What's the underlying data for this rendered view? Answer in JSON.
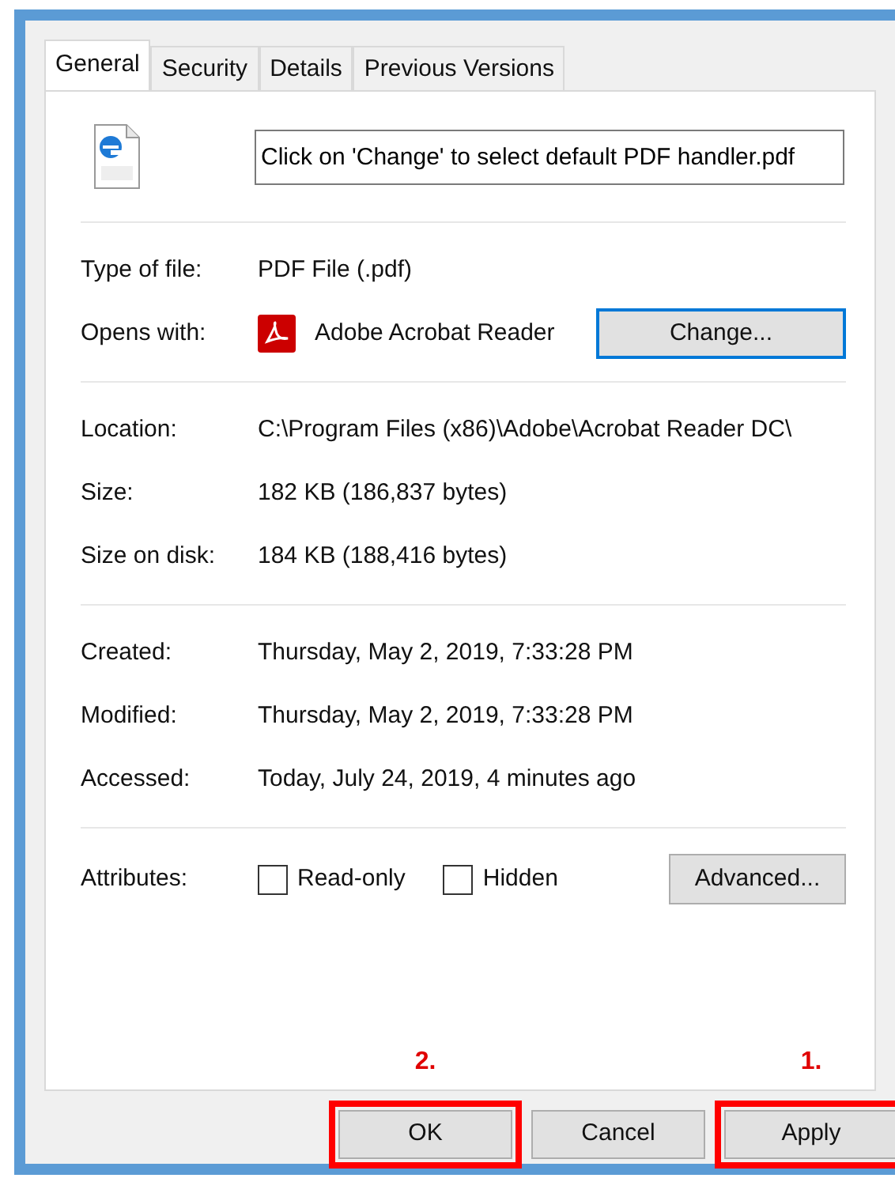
{
  "tabs": [
    {
      "label": "General",
      "selected": true
    },
    {
      "label": "Security",
      "selected": false
    },
    {
      "label": "Details",
      "selected": false
    },
    {
      "label": "Previous Versions",
      "selected": false
    }
  ],
  "file_name": {
    "value": "Click on 'Change' to select default PDF handler.pdf"
  },
  "sections": [
    {
      "rows": [
        {
          "label": "Type of file:",
          "value": "PDF File (.pdf)"
        },
        {
          "kind": "app",
          "label": "Opens with:",
          "value": "Adobe Acrobat Reader",
          "button": "Change...",
          "focused": true
        }
      ]
    },
    {
      "rows": [
        {
          "label": "Location:",
          "value": "C:\\Program Files (x86)\\Adobe\\Acrobat Reader DC\\"
        },
        {
          "label": "Size:",
          "value": "182 KB (186,837 bytes)"
        },
        {
          "label": "Size on disk:",
          "value": "184 KB (188,416 bytes)"
        }
      ]
    },
    {
      "rows": [
        {
          "label": "Created:",
          "value": "Thursday, May 2, 2019, 7:33:28 PM"
        },
        {
          "label": "Modified:",
          "value": "Thursday, May 2, 2019, 7:33:28 PM"
        },
        {
          "label": "Accessed:",
          "value": "Today, July 24, 2019, 4 minutes ago"
        }
      ]
    }
  ],
  "attributes": {
    "label": "Attributes:",
    "checkboxes": [
      {
        "label": "Read-only",
        "checked": false
      },
      {
        "label": "Hidden",
        "checked": false
      }
    ],
    "button": "Advanced..."
  },
  "buttons": [
    {
      "label": "OK",
      "highlighted": true,
      "annotation": "2."
    },
    {
      "label": "Cancel",
      "highlighted": false
    },
    {
      "label": "Apply",
      "highlighted": true,
      "annotation": "1."
    }
  ]
}
